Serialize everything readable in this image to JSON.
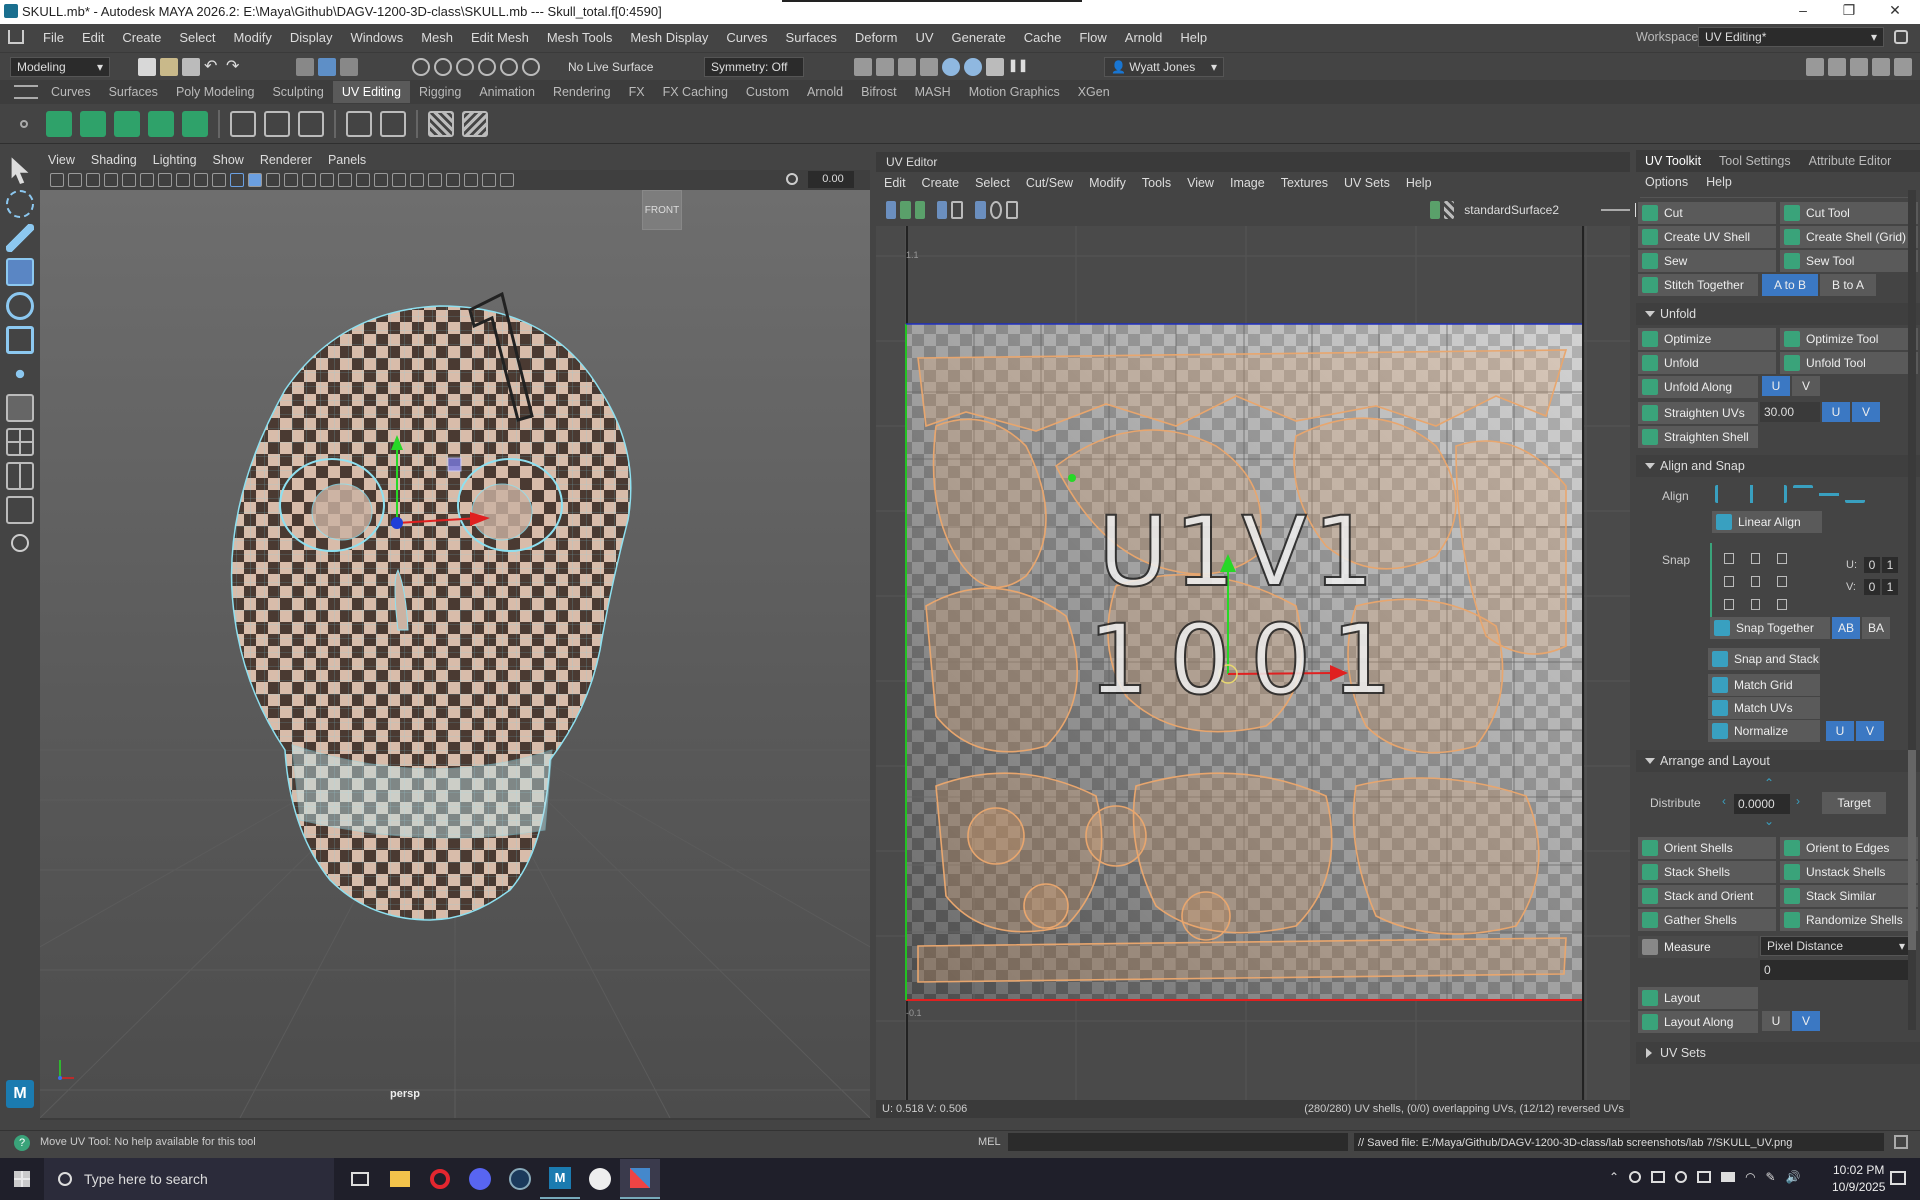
{
  "window": {
    "title": "SKULL.mb* - Autodesk MAYA 2026.2: E:\\Maya\\Github\\DAGV-1200-3D-class\\SKULL.mb  ---  Skull_total.f[0:4590]",
    "minimize": "–",
    "restore": "❐",
    "close": "✕"
  },
  "menubar": {
    "items": [
      "File",
      "Edit",
      "Create",
      "Select",
      "Modify",
      "Display",
      "Windows",
      "Mesh",
      "Edit Mesh",
      "Mesh Tools",
      "Mesh Display",
      "Curves",
      "Surfaces",
      "Deform",
      "UV",
      "Generate",
      "Cache",
      "Flow",
      "Arnold",
      "Help"
    ],
    "workspace_label": "Workspace:",
    "workspace_value": "UV Editing*"
  },
  "statusline": {
    "mode": "Modeling",
    "live_surface": "No Live Surface",
    "symmetry": "Symmetry: Off",
    "user": "Wyatt Jones"
  },
  "shelf": {
    "tabs": [
      "Curves",
      "Surfaces",
      "Poly Modeling",
      "Sculpting",
      "UV Editing",
      "Rigging",
      "Animation",
      "Rendering",
      "FX",
      "FX Caching",
      "Custom",
      "Arnold",
      "Bifrost",
      "MASH",
      "Motion Graphics",
      "XGen"
    ],
    "active_tab": "UV Editing"
  },
  "viewport": {
    "menu": [
      "View",
      "Shading",
      "Lighting",
      "Show",
      "Renderer",
      "Panels"
    ],
    "field_value": "0.00",
    "camera_label": "persp",
    "viewcube_label": "FRONT"
  },
  "uv_editor": {
    "title": "UV Editor",
    "menu": [
      "Edit",
      "Create",
      "Select",
      "Cut/Sew",
      "Modify",
      "Tools",
      "View",
      "Image",
      "Textures",
      "UV Sets",
      "Help"
    ],
    "texture_name": "standardSurface2",
    "tile_label": "U1V1",
    "udim_label": "1001",
    "axis_top": "1.1",
    "axis_bottom": "-0.1",
    "status_coords": "U: 0.518 V: 0.506",
    "status_info": "(280/280) UV shells, (0/0) overlapping UVs, (12/12) reversed UVs"
  },
  "uv_toolkit": {
    "tabs": [
      "UV Toolkit",
      "Tool Settings",
      "Attribute Editor"
    ],
    "menu": [
      "Options",
      "Help"
    ],
    "cut_rows": [
      [
        "Cut",
        "Cut Tool"
      ],
      [
        "Create UV Shell",
        "Create Shell (Grid)"
      ],
      [
        "Sew",
        "Sew Tool"
      ]
    ],
    "stitch": {
      "label": "Stitch Together",
      "a_to_b": "A to B",
      "b_to_a": "B to A"
    },
    "unfold": {
      "header": "Unfold",
      "rows": [
        [
          "Optimize",
          "Optimize Tool"
        ],
        [
          "Unfold",
          "Unfold Tool"
        ]
      ],
      "unfold_along": "Unfold Along",
      "u": "U",
      "v": "V",
      "straighten_uvs": "Straighten UVs",
      "straighten_value": "30.00",
      "straighten_shell": "Straighten Shell"
    },
    "align_snap": {
      "header": "Align and Snap",
      "align_label": "Align",
      "linear_align": "Linear Align",
      "snap_label": "Snap",
      "u_label": "U:",
      "v_label": "V:",
      "u_vals": [
        "0",
        "1"
      ],
      "v_vals": [
        "0",
        "1"
      ],
      "snap_together": "Snap Together",
      "ab": "AB",
      "ba": "BA",
      "snap_and_stack": "Snap and Stack",
      "match_grid": "Match Grid",
      "match_uvs": "Match UVs",
      "normalize": "Normalize"
    },
    "arrange": {
      "header": "Arrange and Layout",
      "distribute": "Distribute",
      "distribute_value": "0.0000",
      "target": "Target",
      "rows": [
        [
          "Orient Shells",
          "Orient to Edges"
        ],
        [
          "Stack Shells",
          "Unstack Shells"
        ],
        [
          "Stack and Orient",
          "Stack Similar"
        ],
        [
          "Gather Shells",
          "Randomize Shells"
        ]
      ],
      "measure": "Measure",
      "measure_mode": "Pixel Distance",
      "measure_value": "0",
      "layout": "Layout",
      "layout_along": "Layout Along"
    },
    "uv_sets_header": "UV Sets"
  },
  "helpline": {
    "help_text": "Move UV Tool: No help available for this tool",
    "mel_label": "MEL",
    "result": "// Saved file: E:/Maya/Github/DAGV-1200-3D-class/lab screenshots/lab 7/SKULL_UV.png"
  },
  "taskbar": {
    "search_placeholder": "Type here to search",
    "time": "10:02 PM",
    "date": "10/9/2025"
  },
  "colors": {
    "accent_blue": "#3b78c3",
    "maya_bg": "#444444",
    "uv_shell_orange": "#e8a66e"
  }
}
